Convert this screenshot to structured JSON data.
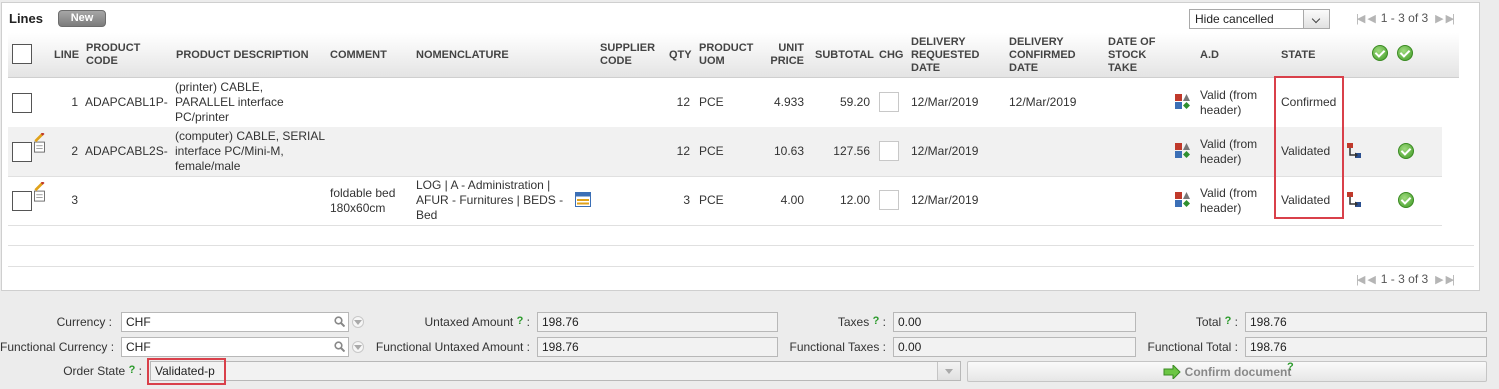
{
  "lines": {
    "title": "Lines",
    "new_button": "New",
    "filter": {
      "selected": "Hide cancelled"
    },
    "pager": {
      "count": "1 - 3 of 3"
    },
    "columns": {
      "line": "LINE",
      "product_code": "PRODUCT CODE",
      "product_description": "PRODUCT DESCRIPTION",
      "comment": "COMMENT",
      "nomenclature": "NOMENCLATURE",
      "supplier_code": "SUPPLIER CODE",
      "qty": "QTY",
      "product_uom": "PRODUCT UOM",
      "unit_price": "UNIT PRICE",
      "subtotal": "SUBTOTAL",
      "chg": "CHG",
      "delivery_requested_date": "DELIVERY REQUESTED DATE",
      "delivery_confirmed_date": "DELIVERY CONFIRMED DATE",
      "date_of_stock_take": "DATE OF STOCK TAKE",
      "ad": "A.D",
      "state": "STATE"
    },
    "rows": [
      {
        "line": "1",
        "product_code": "ADAPCABL1P-",
        "product_description": "(printer) CABLE, PARALLEL interface PC/printer",
        "comment": "",
        "nomenclature": "",
        "qty": "12",
        "uom": "PCE",
        "unit_price": "4.933",
        "subtotal": "59.20",
        "requested_date": "12/Mar/2019",
        "confirmed_date": "12/Mar/2019",
        "ad": "Valid (from header)",
        "state": "Confirmed"
      },
      {
        "line": "2",
        "product_code": "ADAPCABL2S-",
        "product_description": "(computer) CABLE, SERIAL interface PC/Mini-M, female/male",
        "comment": "",
        "nomenclature": "",
        "qty": "12",
        "uom": "PCE",
        "unit_price": "10.63",
        "subtotal": "127.56",
        "requested_date": "12/Mar/2019",
        "confirmed_date": "",
        "ad": "Valid (from header)",
        "state": "Validated"
      },
      {
        "line": "3",
        "product_code": "",
        "product_description": "",
        "comment": "foldable bed 180x60cm",
        "nomenclature": "LOG | A - Administration | AFUR - Furnitures | BEDS - Bed",
        "qty": "3",
        "uom": "PCE",
        "unit_price": "4.00",
        "subtotal": "12.00",
        "requested_date": "12/Mar/2019",
        "confirmed_date": "",
        "ad": "Valid (from header)",
        "state": "Validated"
      }
    ]
  },
  "footer": {
    "currency_label": "Currency :",
    "currency_value": "CHF",
    "functional_currency_label": "Functional Currency :",
    "functional_currency_value": "CHF",
    "order_state_label": "Order State",
    "order_state_value": "Validated-p",
    "untaxed_label": "Untaxed Amount",
    "untaxed_value": "198.76",
    "functional_untaxed_label": "Functional Untaxed Amount :",
    "functional_untaxed_value": "198.76",
    "taxes_label": "Taxes",
    "taxes_value": "0.00",
    "functional_taxes_label": "Functional Taxes :",
    "functional_taxes_value": "0.00",
    "total_label": "Total",
    "total_value": "198.76",
    "functional_total_label": "Functional Total :",
    "functional_total_value": "198.76",
    "help_mark": "?",
    "colon": ":",
    "confirm_button": "Confirm document"
  },
  "colors": {
    "highlight_red": "#d9404a",
    "check_green": "#3f9a25"
  },
  "icons": [
    "check-circle-icon",
    "shapes-icon",
    "edit-pencil-icon",
    "workflow-icon",
    "calendar-icon",
    "magnifier-icon",
    "arrow-right-icon"
  ]
}
